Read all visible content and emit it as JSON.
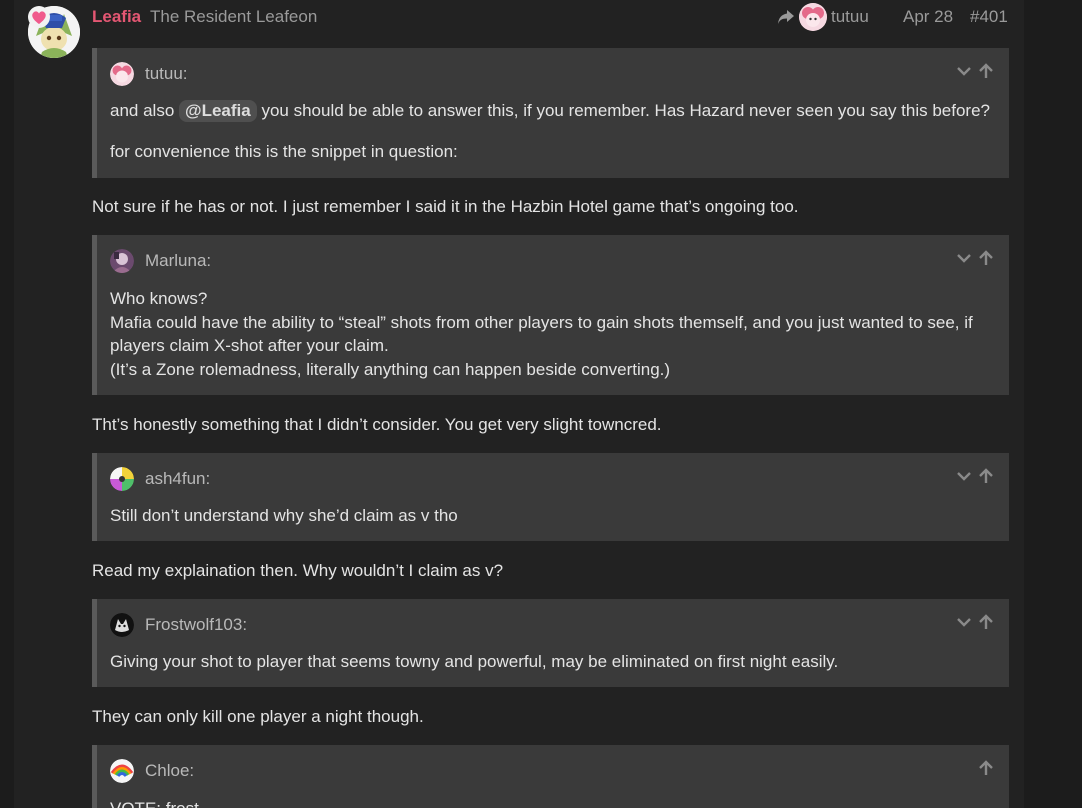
{
  "post": {
    "username": "Leafia",
    "user_title": "The Resident Leafeon",
    "reply_to_name": "tutuu",
    "date": "Apr 28",
    "post_number": "#401"
  },
  "quote1": {
    "name": "tutuu:",
    "line1_before": "and also ",
    "mention": "@Leafia",
    "line1_after": " you should be able to answer this, if you remember. Has Hazard never seen you say this before?",
    "line2": "for convenience this is the snippet in question:"
  },
  "reply1": "Not sure if he has or not. I just remember I said it in the Hazbin Hotel game that’s ongoing too.",
  "quote2": {
    "name": "Marluna:",
    "lines": [
      "Who knows?",
      "Mafia could have the ability to “steal” shots from other players to gain shots themself, and you just wanted to see, if",
      "players claim X-shot after your claim.",
      "(It’s a Zone rolemadness, literally anything can happen beside converting.)"
    ]
  },
  "reply2": "Tht’s honestly something that I didn’t consider. You get very slight towncred.",
  "quote3": {
    "name": "ash4fun:",
    "line": "Still don’t understand why she’d claim as v tho"
  },
  "reply3": "Read my explaination then. Why wouldn’t I claim as v?",
  "quote4": {
    "name": "Frostwolf103:",
    "line": "Giving your shot to player that seems towny and powerful, may be eliminated on first night easily."
  },
  "reply4": "They can only kill one player a night though.",
  "quote5": {
    "name": "Chloe:",
    "line": "VOTE: frost"
  },
  "colors": {
    "background": "#222222",
    "quote_bg": "#3a3a3a",
    "username": "#e45773",
    "muted_text": "#9a9a9a"
  },
  "icons": [
    "reply-arrow-icon",
    "chevron-down-icon",
    "arrow-up-icon",
    "heart-icon"
  ]
}
